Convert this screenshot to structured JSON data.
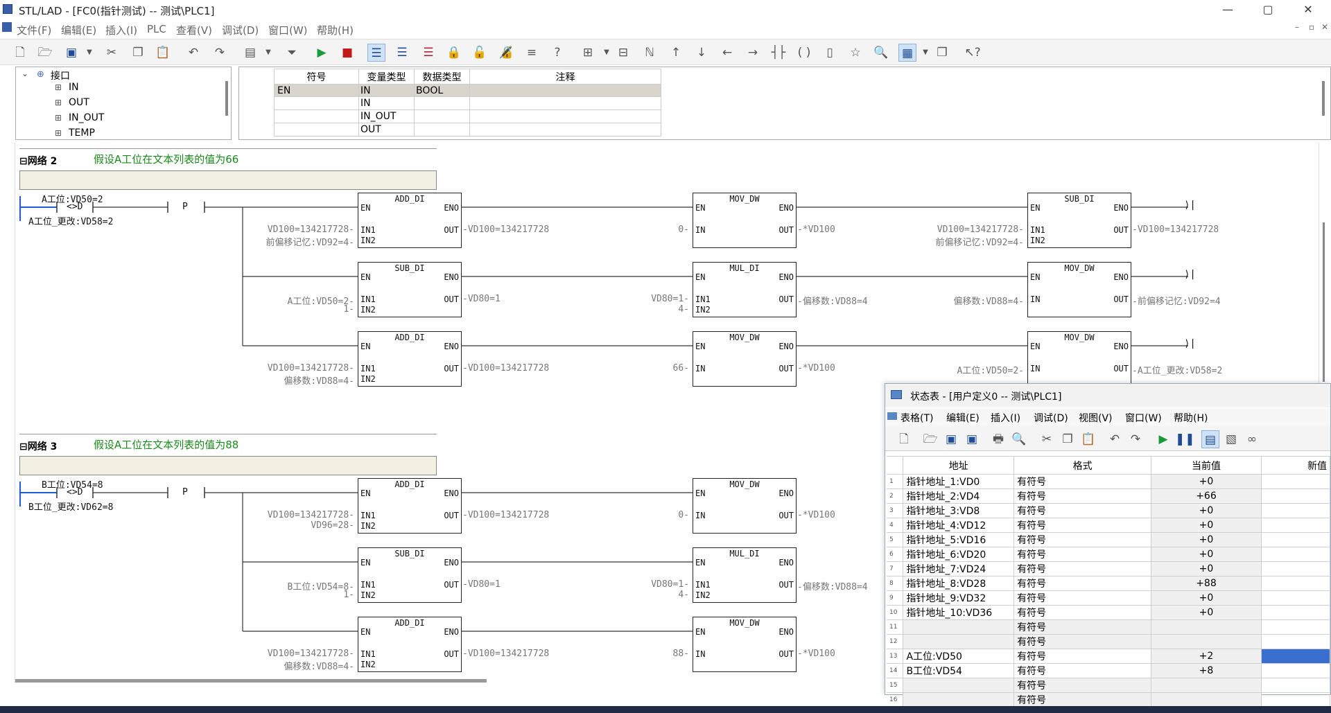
{
  "window": {
    "title": "STL/LAD - [FC0(指针测试) -- 测试\\PLC1]"
  },
  "menu": [
    "文件(F)",
    "编辑(E)",
    "插入(I)",
    "PLC",
    "查看(V)",
    "调试(D)",
    "窗口(W)",
    "帮助(H)"
  ],
  "tree": {
    "root": "接口",
    "items": [
      "IN",
      "OUT",
      "IN_OUT",
      "TEMP"
    ]
  },
  "vartable": {
    "headers": [
      "符号",
      "变量类型",
      "数据类型",
      "注释"
    ],
    "rows": [
      [
        "EN",
        "IN",
        "BOOL",
        ""
      ],
      [
        "",
        "IN",
        "",
        ""
      ],
      [
        "",
        "IN_OUT",
        "",
        ""
      ],
      [
        "",
        "OUT",
        "",
        ""
      ]
    ]
  },
  "networks": [
    {
      "label": "网络 2",
      "comment": "假设A工位在文本列表的值为66",
      "contact_top": "A工位:VD50=2",
      "contact_op": "<>D",
      "contact_bot": "A工位_更改:VD58=2",
      "p": "P",
      "rows": [
        {
          "b1": {
            "name": "ADD_DI",
            "in1": "VD100=134217728",
            "in2": "前偏移记忆:VD92=4",
            "out": "VD100=134217728"
          },
          "b2": {
            "name": "MOV_DW",
            "in": "0",
            "out": "*VD100"
          },
          "b3": {
            "name": "SUB_DI",
            "in1": "VD100=134217728",
            "in2": "前偏移记忆:VD92=4",
            "out": "VD100=134217728"
          }
        },
        {
          "b1": {
            "name": "SUB_DI",
            "in1": "A工位:VD50=2",
            "in2": "1",
            "out": "VD80=1"
          },
          "b2": {
            "name": "MUL_DI",
            "in1": "VD80=1",
            "in2": "4",
            "out": "偏移数:VD88=4"
          },
          "b3": {
            "name": "MOV_DW",
            "in": "偏移数:VD88=4",
            "out": "前偏移记忆:VD92=4"
          }
        },
        {
          "b1": {
            "name": "ADD_DI",
            "in1": "VD100=134217728",
            "in2": "偏移数:VD88=4",
            "out": "VD100=134217728"
          },
          "b2": {
            "name": "MOV_DW",
            "in": "66",
            "out": "*VD100"
          },
          "b3": {
            "name": "MOV_DW",
            "in": "A工位:VD50=2",
            "out": "A工位_更改:VD58=2"
          }
        }
      ]
    },
    {
      "label": "网络 3",
      "comment": "假设A工位在文本列表的值为88",
      "contact_top": "B工位:VD54=8",
      "contact_op": "<>D",
      "contact_bot": "B工位_更改:VD62=8",
      "p": "P",
      "rows": [
        {
          "b1": {
            "name": "ADD_DI",
            "in1": "VD100=134217728",
            "in2": "VD96=28",
            "out": "VD100=134217728"
          },
          "b2": {
            "name": "MOV_DW",
            "in": "0",
            "out": "*VD100"
          }
        },
        {
          "b1": {
            "name": "SUB_DI",
            "in1": "B工位:VD54=8",
            "in2": "1",
            "out": "VD80=1"
          },
          "b2": {
            "name": "MUL_DI",
            "in1": "VD80=1",
            "in2": "4",
            "out": "偏移数:VD88=4"
          }
        },
        {
          "b1": {
            "name": "ADD_DI",
            "in1": "VD100=134217728",
            "in2": "偏移数:VD88=4",
            "out": "VD100=134217728"
          },
          "b2": {
            "name": "MOV_DW",
            "in": "88",
            "out": "*VD100"
          }
        }
      ]
    }
  ],
  "box_pins": {
    "en": "EN",
    "eno": "ENO",
    "in1": "IN1",
    "in2": "IN2",
    "in": "IN",
    "out": "OUT"
  },
  "statuswin": {
    "title": "状态表 - [用户定义0 -- 测试\\PLC1]",
    "menu": [
      "表格(T)",
      "编辑(E)",
      "插入(I)",
      "调试(D)",
      "视图(V)",
      "窗口(W)",
      "帮助(H)"
    ],
    "headers": [
      "地址",
      "格式",
      "当前值",
      "新值"
    ],
    "rows": [
      [
        "1",
        "指针地址_1:VD0",
        "有符号",
        "+0"
      ],
      [
        "2",
        "指针地址_2:VD4",
        "有符号",
        "+66"
      ],
      [
        "3",
        "指针地址_3:VD8",
        "有符号",
        "+0"
      ],
      [
        "4",
        "指针地址_4:VD12",
        "有符号",
        "+0"
      ],
      [
        "5",
        "指针地址_5:VD16",
        "有符号",
        "+0"
      ],
      [
        "6",
        "指针地址_6:VD20",
        "有符号",
        "+0"
      ],
      [
        "7",
        "指针地址_7:VD24",
        "有符号",
        "+0"
      ],
      [
        "8",
        "指针地址_8:VD28",
        "有符号",
        "+88"
      ],
      [
        "9",
        "指针地址_9:VD32",
        "有符号",
        "+0"
      ],
      [
        "10",
        "指针地址_10:VD36",
        "有符号",
        "+0"
      ],
      [
        "11",
        "",
        "有符号",
        ""
      ],
      [
        "12",
        "",
        "有符号",
        ""
      ],
      [
        "13",
        "A工位:VD50",
        "有符号",
        "+2"
      ],
      [
        "14",
        "B工位:VD54",
        "有符号",
        "+8"
      ],
      [
        "15",
        "",
        "有符号",
        ""
      ],
      [
        "16",
        "",
        "有符号",
        ""
      ]
    ]
  },
  "colors": {
    "accent": "#1e5bd6",
    "comment_green": "#1a8a1a",
    "selected_new": "#3b6fcf"
  }
}
